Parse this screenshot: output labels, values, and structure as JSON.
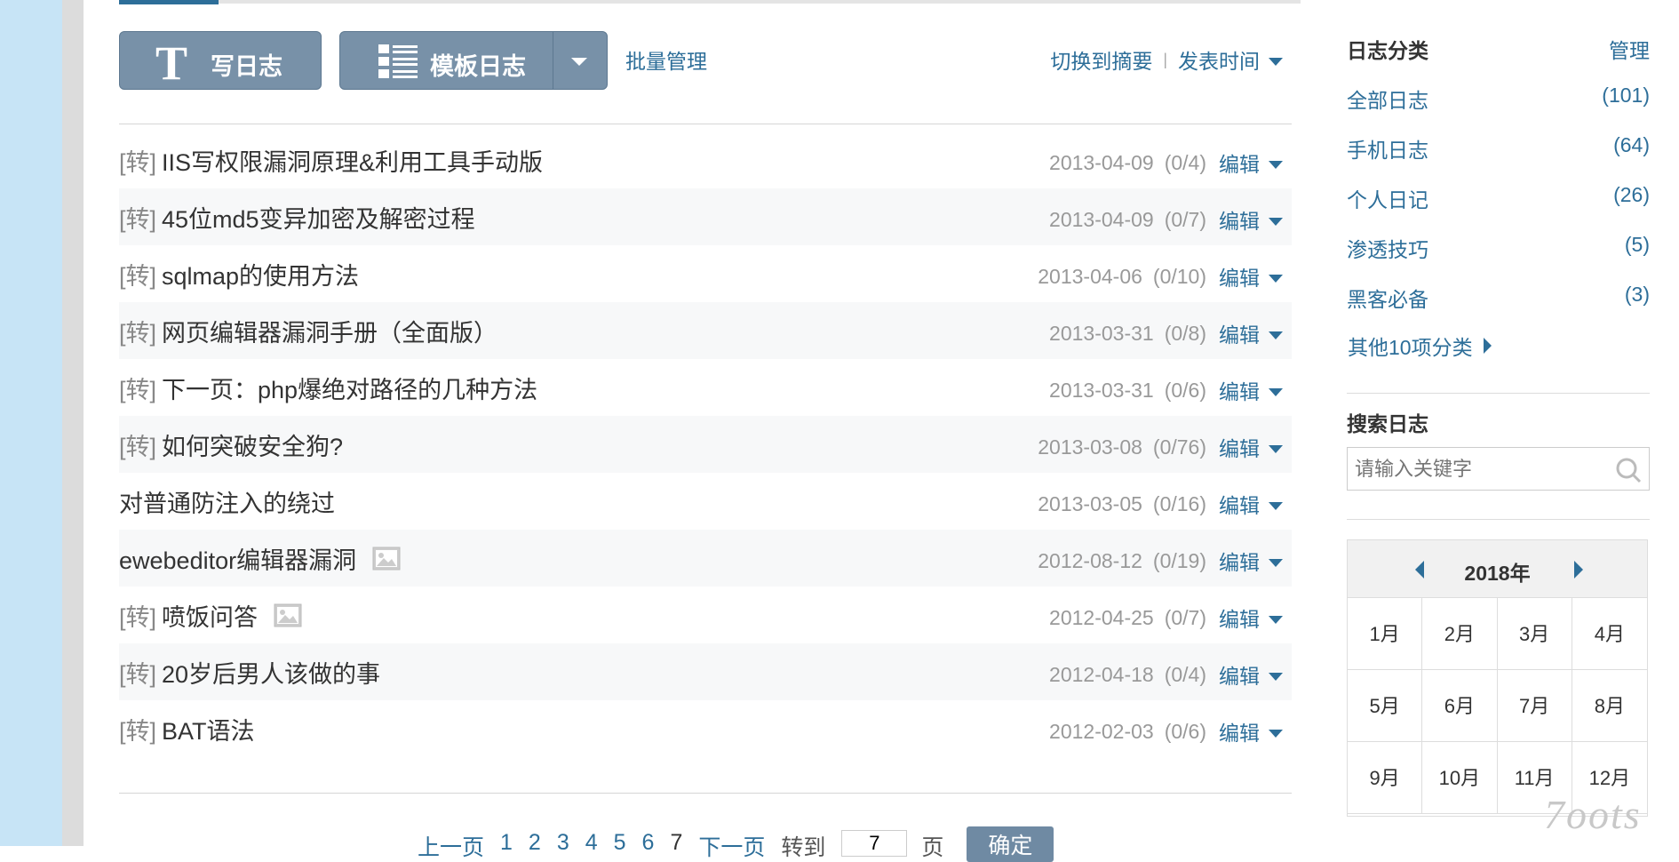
{
  "toolbar": {
    "write_label": "写日志",
    "write_icon_glyph": "T",
    "template_label": "模板日志",
    "batch_label": "批量管理",
    "switch_summary": "切换到摘要",
    "separator": "|",
    "sort_label": "发表时间"
  },
  "posts": [
    {
      "tag": "[转]",
      "title": "IIS写权限漏洞原理&利用工具手动版",
      "date": "2013-04-09",
      "count": "(0/4)",
      "edit": "编辑",
      "has_image": false
    },
    {
      "tag": "[转]",
      "title": "45位md5变异加密及解密过程",
      "date": "2013-04-09",
      "count": "(0/7)",
      "edit": "编辑",
      "has_image": false
    },
    {
      "tag": "[转]",
      "title": "sqlmap的使用方法",
      "date": "2013-04-06",
      "count": "(0/10)",
      "edit": "编辑",
      "has_image": false
    },
    {
      "tag": "[转]",
      "title": "网页编辑器漏洞手册（全面版）",
      "date": "2013-03-31",
      "count": "(0/8)",
      "edit": "编辑",
      "has_image": false
    },
    {
      "tag": "[转]",
      "title": "下一页：php爆绝对路径的几种方法",
      "date": "2013-03-31",
      "count": "(0/6)",
      "edit": "编辑",
      "has_image": false
    },
    {
      "tag": "[转]",
      "title": "如何突破安全狗?",
      "date": "2013-03-08",
      "count": "(0/76)",
      "edit": "编辑",
      "has_image": false
    },
    {
      "tag": "",
      "title": "对普通防注入的绕过",
      "date": "2013-03-05",
      "count": "(0/16)",
      "edit": "编辑",
      "has_image": false
    },
    {
      "tag": "",
      "title": "ewebeditor编辑器漏洞",
      "date": "2012-08-12",
      "count": "(0/19)",
      "edit": "编辑",
      "has_image": true
    },
    {
      "tag": "[转]",
      "title": "喷饭问答",
      "date": "2012-04-25",
      "count": "(0/7)",
      "edit": "编辑",
      "has_image": true
    },
    {
      "tag": "[转]",
      "title": "20岁后男人该做的事",
      "date": "2012-04-18",
      "count": "(0/4)",
      "edit": "编辑",
      "has_image": false
    },
    {
      "tag": "[转]",
      "title": "BAT语法",
      "date": "2012-02-03",
      "count": "(0/6)",
      "edit": "编辑",
      "has_image": false
    }
  ],
  "pagination": {
    "prev": "上一页",
    "pages": [
      "1",
      "2",
      "3",
      "4",
      "5",
      "6"
    ],
    "current": "7",
    "next": "下一页",
    "goto_label": "转到",
    "goto_value": "7",
    "page_unit": "页",
    "confirm": "确定"
  },
  "sidebar": {
    "categories_title": "日志分类",
    "manage_label": "管理",
    "categories": [
      {
        "name": "全部日志",
        "count": "(101)"
      },
      {
        "name": "手机日志",
        "count": "(64)"
      },
      {
        "name": "个人日记",
        "count": "(26)"
      },
      {
        "name": "渗透技巧",
        "count": "(5)"
      },
      {
        "name": "黑客必备",
        "count": "(3)"
      }
    ],
    "more_categories": "其他10项分类",
    "search_title": "搜索日志",
    "search_placeholder": "请输入关键字",
    "calendar": {
      "year": "2018年",
      "months": [
        "1月",
        "2月",
        "3月",
        "4月",
        "5月",
        "6月",
        "7月",
        "8月",
        "9月",
        "10月",
        "11月",
        "12月"
      ]
    }
  },
  "watermark": "7oots",
  "colors": {
    "link": "#2d6e99",
    "button": "#7891a8",
    "muted": "#999999"
  }
}
